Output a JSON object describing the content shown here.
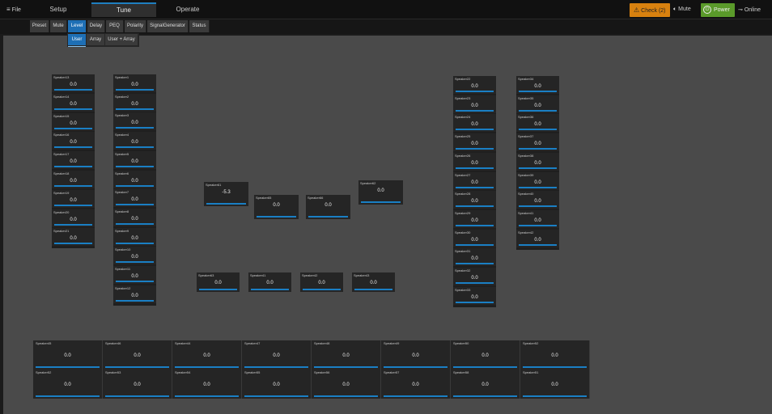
{
  "menu": {
    "file": "File"
  },
  "main_tabs": [
    "Setup",
    "Tune",
    "Operate"
  ],
  "status": {
    "check": "Check (2)",
    "mute": "Mute",
    "power": "Power",
    "online": "Online"
  },
  "sub_tabs": [
    "Preset",
    "Mute",
    "Level",
    "Delay",
    "PEQ",
    "Polarity",
    "SignalGenerator",
    "Status"
  ],
  "level_tabs": [
    "User",
    "Array",
    "User + Array"
  ],
  "speakers": {
    "col1": [
      {
        "name": "Speaker13",
        "value": "0.0"
      },
      {
        "name": "Speaker14",
        "value": "0.0"
      },
      {
        "name": "Speaker15",
        "value": "0.0"
      },
      {
        "name": "Speaker16",
        "value": "0.0"
      },
      {
        "name": "Speaker17",
        "value": "0.0"
      },
      {
        "name": "Speaker18",
        "value": "0.0"
      },
      {
        "name": "Speaker19",
        "value": "0.0"
      },
      {
        "name": "Speaker20",
        "value": "0.0"
      },
      {
        "name": "Speaker21",
        "value": "0.0"
      }
    ],
    "col2": [
      {
        "name": "Speaker1",
        "value": "0.0"
      },
      {
        "name": "Speaker2",
        "value": "0.0"
      },
      {
        "name": "Speaker3",
        "value": "0.0"
      },
      {
        "name": "Speaker4",
        "value": "0.0"
      },
      {
        "name": "Speaker5",
        "value": "0.0"
      },
      {
        "name": "Speaker6",
        "value": "0.0"
      },
      {
        "name": "Speaker7",
        "value": "0.0"
      },
      {
        "name": "Speaker8",
        "value": "0.0"
      },
      {
        "name": "Speaker9",
        "value": "0.0"
      },
      {
        "name": "Speaker10",
        "value": "0.0"
      },
      {
        "name": "Speaker11",
        "value": "0.0"
      },
      {
        "name": "Speaker12",
        "value": "0.0"
      }
    ],
    "center_top": [
      {
        "name": "Speaker61",
        "value": "-5.3"
      },
      {
        "name": "Speaker65",
        "value": "0.0"
      },
      {
        "name": "Speaker66",
        "value": "0.0"
      },
      {
        "name": "Speaker62",
        "value": "0.0"
      }
    ],
    "center_mid": [
      {
        "name": "Speaker63",
        "value": "0.0"
      },
      {
        "name": "Speaker41",
        "value": "0.0"
      },
      {
        "name": "Speaker42",
        "value": "0.0"
      },
      {
        "name": "Speaker43",
        "value": "0.0"
      }
    ],
    "col3": [
      {
        "name": "Speaker22",
        "value": "0.0"
      },
      {
        "name": "Speaker23",
        "value": "0.0"
      },
      {
        "name": "Speaker24",
        "value": "0.0"
      },
      {
        "name": "Speaker25",
        "value": "0.0"
      },
      {
        "name": "Speaker26",
        "value": "0.0"
      },
      {
        "name": "Speaker27",
        "value": "0.0"
      },
      {
        "name": "Speaker28",
        "value": "0.0"
      },
      {
        "name": "Speaker29",
        "value": "0.0"
      },
      {
        "name": "Speaker30",
        "value": "0.0"
      },
      {
        "name": "Speaker31",
        "value": "0.0"
      },
      {
        "name": "Speaker32",
        "value": "0.0"
      },
      {
        "name": "Speaker33",
        "value": "0.0"
      }
    ],
    "col4": [
      {
        "name": "Speaker34",
        "value": "0.0"
      },
      {
        "name": "Speaker35",
        "value": "0.0"
      },
      {
        "name": "Speaker36",
        "value": "0.0"
      },
      {
        "name": "Speaker37",
        "value": "0.0"
      },
      {
        "name": "Speaker38",
        "value": "0.0"
      },
      {
        "name": "Speaker39",
        "value": "0.0"
      },
      {
        "name": "Speaker40",
        "value": "0.0"
      },
      {
        "name": "Speaker41",
        "value": "0.0"
      },
      {
        "name": "Speaker42",
        "value": "0.0"
      }
    ],
    "bottom_row1": [
      {
        "name": "Speaker45",
        "value": "0.0"
      },
      {
        "name": "Speaker46",
        "value": "0.0"
      },
      {
        "name": "Speaker44",
        "value": "0.0"
      },
      {
        "name": "Speaker47",
        "value": "0.0"
      },
      {
        "name": "Speaker48",
        "value": "0.0"
      },
      {
        "name": "Speaker49",
        "value": "0.0"
      },
      {
        "name": "Speaker50",
        "value": "0.0"
      },
      {
        "name": "Speaker52",
        "value": "0.0"
      }
    ],
    "bottom_row2": [
      {
        "name": "Speaker52",
        "value": "0.0"
      },
      {
        "name": "Speaker53",
        "value": "0.0"
      },
      {
        "name": "Speaker54",
        "value": "0.0"
      },
      {
        "name": "Speaker55",
        "value": "0.0"
      },
      {
        "name": "Speaker56",
        "value": "0.0"
      },
      {
        "name": "Speaker57",
        "value": "0.0"
      },
      {
        "name": "Speaker58",
        "value": "0.0"
      },
      {
        "name": "Speaker51",
        "value": "0.0"
      }
    ]
  },
  "colors": {
    "accent": "#1e6fb5",
    "check": "#d8810f",
    "power": "#5a9a2a",
    "workspace": "#4a4a4a"
  }
}
